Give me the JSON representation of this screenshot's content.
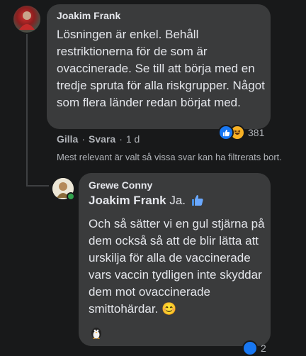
{
  "comment1": {
    "author": "Joakim Frank",
    "text": "Lösningen är enkel. Behåll restriktionerna för de som är ovaccinerade. Se till att börja med en tredje spruta för alla riskgrupper. Något som flera länder redan börjat med.",
    "actions": {
      "like": "Gilla",
      "reply": "Svara",
      "time": "1 d"
    },
    "reactions": {
      "count": "381",
      "icons": [
        "like-icon",
        "haha-icon"
      ]
    }
  },
  "filter_note": "Mest relevant är valt så vissa svar kan ha filtrerats bort.",
  "reply1": {
    "author": "Grewe Conny",
    "mention": "Joakim Frank",
    "mention_suffix": "Ja.",
    "text": "Och så sätter vi en gul stjärna på dem också så att de blir lätta att urskilja för alla de vaccinerade vars vaccin tydligen inte skyddar dem mot ovaccinerade smittohärdar. 😊",
    "online_color": "#31a24c",
    "reaction_partial_count": "2"
  },
  "colors": {
    "background": "#18191a",
    "bubble": "#3a3b3c",
    "like_blue": "#1877f2",
    "haha_yellow": "#f7b125"
  }
}
